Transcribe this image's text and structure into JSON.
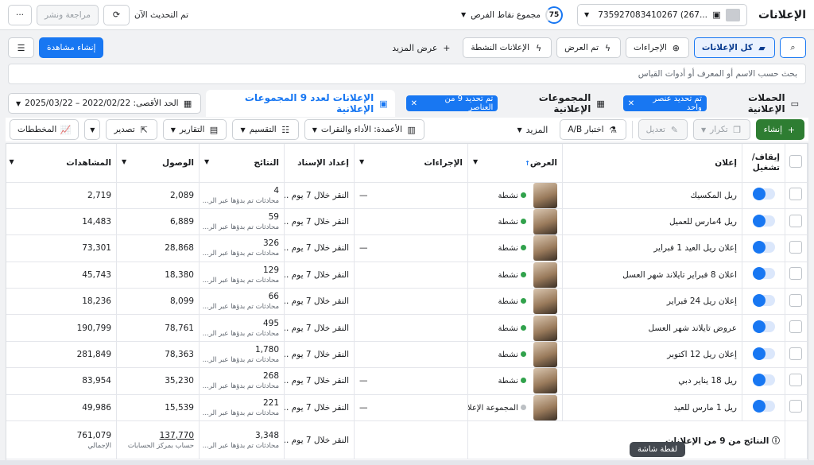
{
  "topbar": {
    "title": "الإعلانات",
    "account_text": "735927083410267 (267...",
    "score_value": "75",
    "score_label": "مجموع نقاط الفرص",
    "update_status": "تم التحديث الآن",
    "review_publish_label": "مراجعة ونشر",
    "more_label": "···"
  },
  "bar2": {
    "all_ads": "كل الإعلانات",
    "actions": "الإجراءات",
    "shown": "تم العرض",
    "active_ads": "الإعلانات النشطة",
    "show_more": "عرض المزيد",
    "create_view": "إنشاء مشاهدة"
  },
  "search": {
    "placeholder": "بحث حسب الاسم أو المعرف أو أدوات القياس"
  },
  "tabs": {
    "campaigns": "الحملات الإعلانية",
    "campaigns_chip": "تم تحديد عنصر واحد",
    "adsets": "المجموعات الإعلانية",
    "adsets_chip": "تم تحديد 9 من العناصر",
    "ads": "الإعلانات لعدد 9 المجموعات الإعلانية",
    "date_range": "الحد الأقصى: 2022/02/22 – 2025/03/22"
  },
  "actions": {
    "create": "إنشاء",
    "duplicate": "تكرار",
    "edit": "تعديل",
    "ab_test": "اختبار A/B",
    "more": "المزيد",
    "columns": "الأعمدة: الأداء والنقرات",
    "breakdown": "التقسيم",
    "reports": "التقارير",
    "export": "تصدير",
    "charts": "المخططات"
  },
  "table": {
    "headers": {
      "onoff": "إيقاف/ تشغيل",
      "ad": "إعلان",
      "delivery": "العرض",
      "actions": "الإجراءات",
      "attribution": "إعداد الإسناد",
      "results": "النتائج",
      "reach": "الوصول",
      "impressions": "المشاهدات"
    },
    "rows": [
      {
        "name": "ريل المكسيك",
        "delivery": "نشطة",
        "actions": "—",
        "attribution": "النقر خلال 7 يوم ...",
        "results": "4",
        "results_sub": "محادثات تم بدؤها عبر الر...",
        "reach": "2,089",
        "impressions": "2,719"
      },
      {
        "name": "ريل 4مارس للعميل",
        "delivery": "نشطة",
        "actions": "",
        "attribution": "النقر خلال 7 يوم ...",
        "results": "59",
        "results_sub": "محادثات تم بدؤها عبر الر...",
        "reach": "6,889",
        "impressions": "14,483"
      },
      {
        "name": "إعلان ريل العيد 1 فبراير",
        "delivery": "نشطة",
        "actions": "—",
        "attribution": "النقر خلال 7 يوم ...",
        "results": "326",
        "results_sub": "محادثات تم بدؤها عبر الر...",
        "reach": "28,868",
        "impressions": "73,301"
      },
      {
        "name": "اعلان 8 فبراير تايلاند شهر العسل",
        "delivery": "نشطة",
        "actions": "",
        "attribution": "النقر خلال 7 يوم ...",
        "results": "129",
        "results_sub": "محادثات تم بدؤها عبر الر...",
        "reach": "18,380",
        "impressions": "45,743"
      },
      {
        "name": "إعلان ريل 24 فبراير",
        "delivery": "نشطة",
        "actions": "",
        "attribution": "النقر خلال 7 يوم ...",
        "results": "66",
        "results_sub": "محادثات تم بدؤها عبر الر...",
        "reach": "8,099",
        "impressions": "18,236"
      },
      {
        "name": "عروض تايلاند شهر العسل",
        "delivery": "نشطة",
        "actions": "",
        "attribution": "النقر خلال 7 يوم ...",
        "results": "495",
        "results_sub": "محادثات تم بدؤها عبر الر...",
        "reach": "78,761",
        "impressions": "190,799"
      },
      {
        "name": "إعلان ريل 12 اكتوبر",
        "delivery": "نشطة",
        "actions": "",
        "attribution": "النقر خلال 7 يوم ...",
        "results": "1,780",
        "results_sub": "محادثات تم بدؤها عبر الر...",
        "reach": "78,363",
        "impressions": "281,849"
      },
      {
        "name": "ريل 18 يناير دبي",
        "delivery": "نشطة",
        "actions": "—",
        "attribution": "النقر خلال 7 يوم ...",
        "results": "268",
        "results_sub": "محادثات تم بدؤها عبر الر...",
        "reach": "35,230",
        "impressions": "83,954"
      },
      {
        "name": "ريل 1 مارس للعيد",
        "delivery": "المجموعة الإعلانية متوا",
        "actions": "—",
        "attribution": "النقر خلال 7 يوم ...",
        "results": "221",
        "results_sub": "محادثات تم بدؤها عبر الر...",
        "reach": "15,539",
        "impressions": "49,986"
      }
    ],
    "footer": {
      "label": "النتائج من 9 من الإعلانات",
      "attribution": "النقر خلال 7 يوم ...",
      "results": "3,348",
      "results_sub": "محادثات تم بدؤها عبر الر...",
      "reach": "137,770",
      "reach_sub": "حساب بمركز الحسابات",
      "impressions": "761,079",
      "impressions_sub": "الإجمالي"
    }
  },
  "tooltip": "لقطة شاشة"
}
